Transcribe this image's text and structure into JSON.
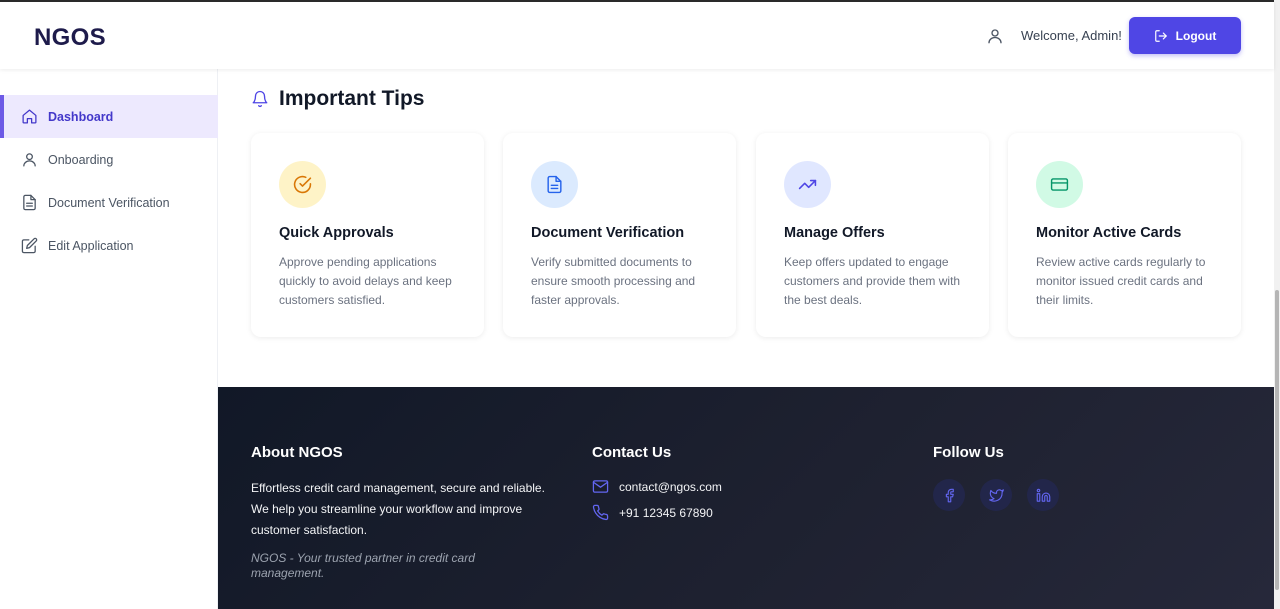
{
  "header": {
    "logo": "NGOS",
    "welcome": "Welcome, Admin!",
    "logout_label": "Logout",
    "user_icon": "user-icon",
    "logout_icon": "logout-icon"
  },
  "sidebar": {
    "items": [
      {
        "label": "Dashboard",
        "icon": "home-icon",
        "active": true
      },
      {
        "label": "Onboarding",
        "icon": "user-icon",
        "active": false
      },
      {
        "label": "Document Verification",
        "icon": "document-icon",
        "active": false
      },
      {
        "label": "Edit Application",
        "icon": "edit-icon",
        "active": false
      }
    ]
  },
  "tips": {
    "title": "Important Tips",
    "icon": "bell-icon",
    "cards": [
      {
        "title": "Quick Approvals",
        "desc": "Approve pending applications quickly to avoid delays and keep customers satisfied.",
        "icon": "check-circle-icon",
        "icon_bg": "#fef3c7",
        "icon_color": "#d97706"
      },
      {
        "title": "Document Verification",
        "desc": "Verify submitted documents to ensure smooth processing and faster approvals.",
        "icon": "document-icon",
        "icon_bg": "#dbeafe",
        "icon_color": "#2563eb"
      },
      {
        "title": "Manage Offers",
        "desc": "Keep offers updated to engage customers and provide them with the best deals.",
        "icon": "trending-up-icon",
        "icon_bg": "#e0e7ff",
        "icon_color": "#4f46e5"
      },
      {
        "title": "Monitor Active Cards",
        "desc": "Review active cards regularly to monitor issued credit cards and their limits.",
        "icon": "credit-card-icon",
        "icon_bg": "#d1fae5",
        "icon_color": "#059669"
      }
    ]
  },
  "footer": {
    "about": {
      "title": "About NGOS",
      "text": "Effortless credit card management, secure and reliable. We help you streamline your workflow and improve customer satisfaction.",
      "tagline": "NGOS - Your trusted partner in credit card management."
    },
    "contact": {
      "title": "Contact Us",
      "email": "contact@ngos.com",
      "phone": "+91 12345 67890"
    },
    "follow": {
      "title": "Follow Us",
      "icons": [
        "facebook-icon",
        "twitter-icon",
        "linkedin-icon"
      ]
    }
  },
  "colors": {
    "accent": "#4f46e5",
    "footer_bg": "#111827",
    "active_bg": "#ede9fe"
  }
}
